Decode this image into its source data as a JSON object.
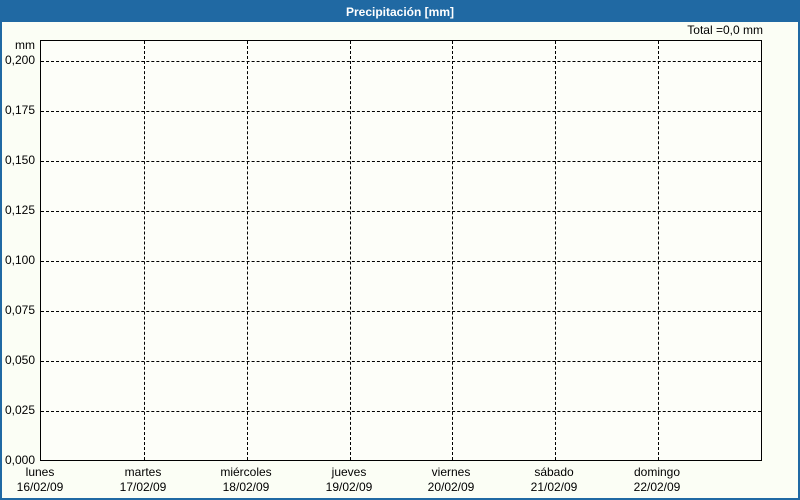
{
  "window": {
    "title": "Precipitación [mm]",
    "total_label": "Total =0,0 mm"
  },
  "chart_data": {
    "type": "bar",
    "title": "Precipitación [mm]",
    "ylabel": "mm",
    "unit": "mm",
    "total": "Total =0,0 mm",
    "ylim": [
      0,
      0.21
    ],
    "grid": true,
    "grid_style": "dashed",
    "legend_position": "none",
    "yticks": [
      {
        "label": "0,000",
        "value": 0
      },
      {
        "label": "0,025",
        "value": 0.025
      },
      {
        "label": "0,050",
        "value": 0.05
      },
      {
        "label": "0,075",
        "value": 0.075
      },
      {
        "label": "0,100",
        "value": 0.1
      },
      {
        "label": "0,125",
        "value": 0.125
      },
      {
        "label": "0,150",
        "value": 0.15
      },
      {
        "label": "0,175",
        "value": 0.175
      },
      {
        "label": "0,200",
        "value": 0.2
      }
    ],
    "categories": [
      {
        "day": "lunes",
        "date": "16/02/09"
      },
      {
        "day": "martes",
        "date": "17/02/09"
      },
      {
        "day": "miércoles",
        "date": "18/02/09"
      },
      {
        "day": "jueves",
        "date": "19/02/09"
      },
      {
        "day": "viernes",
        "date": "20/02/09"
      },
      {
        "day": "sábado",
        "date": "21/02/09"
      },
      {
        "day": "domingo",
        "date": "22/02/09"
      }
    ],
    "series": [
      {
        "name": "Precipitación",
        "values": [
          0,
          0,
          0,
          0,
          0,
          0,
          0
        ]
      }
    ],
    "colors": {
      "titlebar": "#2069A3",
      "border": "#2069A3",
      "background": "#FBFEF5",
      "plot_background": "#FDFEF9",
      "grid": "#000000",
      "text": "#000000"
    }
  }
}
